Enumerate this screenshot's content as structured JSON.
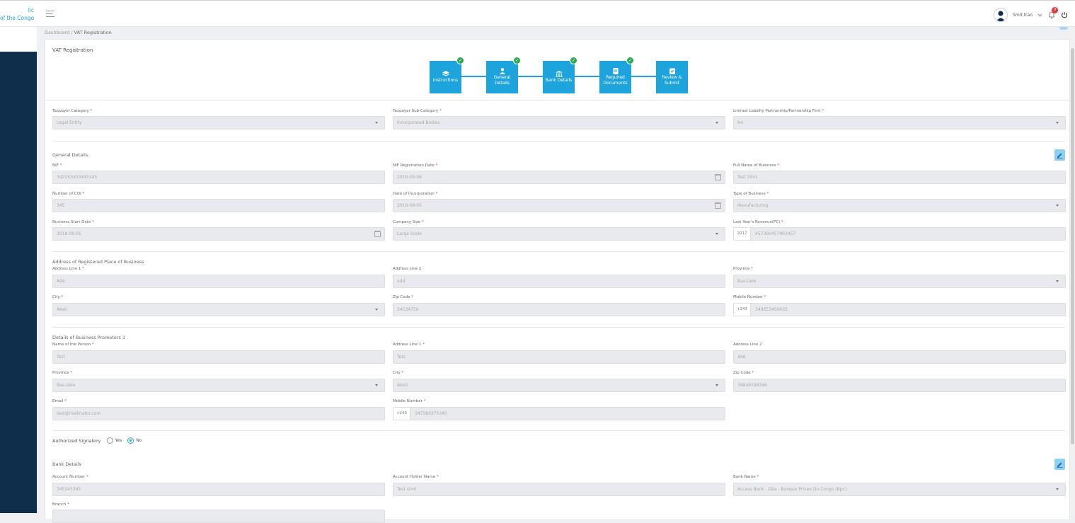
{
  "header": {
    "logo_line1": "lic",
    "logo_line2": "of the Congo",
    "user_name": "Smit tran",
    "notification_count": "0"
  },
  "breadcrumb": {
    "root": "Dashboard",
    "separator": " / ",
    "current": "VAT Registration"
  },
  "page": {
    "title": "VAT Registration"
  },
  "steps": [
    {
      "label_1": "Instructions",
      "label_2": "",
      "icon": "stack-icon",
      "completed": true
    },
    {
      "label_1": "General",
      "label_2": "Details",
      "icon": "user-icon",
      "completed": true
    },
    {
      "label_1": "Bank Details",
      "label_2": "",
      "icon": "bank-icon",
      "completed": true
    },
    {
      "label_1": "Required",
      "label_2": "Documents",
      "icon": "document-icon",
      "completed": true
    },
    {
      "label_1": "Review &",
      "label_2": "Submit",
      "icon": "review-icon",
      "completed": false
    }
  ],
  "taxpayer": {
    "category_label": "Taxpayer Category",
    "category_value": "Legal Entity",
    "subcategory_label": "Taxpayer Sub-Category",
    "subcategory_value": "Incorporated Bodies",
    "llp_label": "Limited Liability Partnership/Partnership Firm",
    "llp_value": "No"
  },
  "general": {
    "section_title": "General Details",
    "nif_label": "NIF",
    "nif_value": "343253453445345",
    "nif_date_label": "NIF Registration Date",
    "nif_date_value": "2018-09-06",
    "full_name_label": "Full Name of Business",
    "full_name_value": "Test Stmt",
    "coi_label": "Number of COI",
    "coi_value": "345",
    "inc_date_label": "Date of Incorporation",
    "inc_date_value": "2018-09-03",
    "business_type_label": "Type of Business",
    "business_type_value": "Manufacturing",
    "start_date_label": "Business Start Date",
    "start_date_value": "2018-09-01",
    "company_size_label": "Company Size",
    "company_size_value": "Large Scale",
    "revenue_label": "Last Year's Revenue(FC)",
    "revenue_prefix": "2017",
    "revenue_value": "457390457903457"
  },
  "address": {
    "section_title": "Address of Registered Place of Business",
    "line1_label": "Address Line 1",
    "line1_value": "Add",
    "line2_label": "Address Line 2",
    "line2_value": "add",
    "province_label": "Province",
    "province_value": "Bas-Uele",
    "city_label": "City",
    "city_value": "Aketi",
    "zip_label": "Zip Code",
    "zip_value": "34534750",
    "mobile_label": "Mobile Number",
    "mobile_prefix": "+243",
    "mobile_value": "340653459035"
  },
  "promoter": {
    "section_title": "Details of Business Promoters 1",
    "name_label": "Name of the Person",
    "name_value": "Test",
    "line1_label": "Address Line 1",
    "line1_value": "Tets",
    "line2_label": "Address Line 2",
    "line2_value": "Add",
    "province_label": "Province",
    "province_value": "Bas-Uele",
    "city_label": "City",
    "city_value": "Aketi",
    "zip_label": "Zip Code",
    "zip_value": "39846598346",
    "email_label": "Email",
    "email_value": "test@mailinator.com",
    "mobile_label": "Mobile Number",
    "mobile_prefix": "+243",
    "mobile_value": "347580375345"
  },
  "signatory": {
    "label": "Authorized Signatory",
    "yes_label": "Yes",
    "no_label": "No",
    "selected": "No"
  },
  "bank": {
    "section_title": "Bank Details",
    "account_label": "Account Number",
    "account_value": "345345345",
    "holder_label": "Account Holder Name",
    "holder_value": "Test stmt",
    "bank_label": "Bank Name",
    "bank_value": "Access Bank - Dba - Banque Privee Du Congo (Bpc)",
    "branch_label": "Branch"
  },
  "required_marker": "*",
  "colors": {
    "accent": "#1ea4dc",
    "sidebar": "#0e2e4b",
    "success": "#2eaa52",
    "required": "#e53935"
  }
}
